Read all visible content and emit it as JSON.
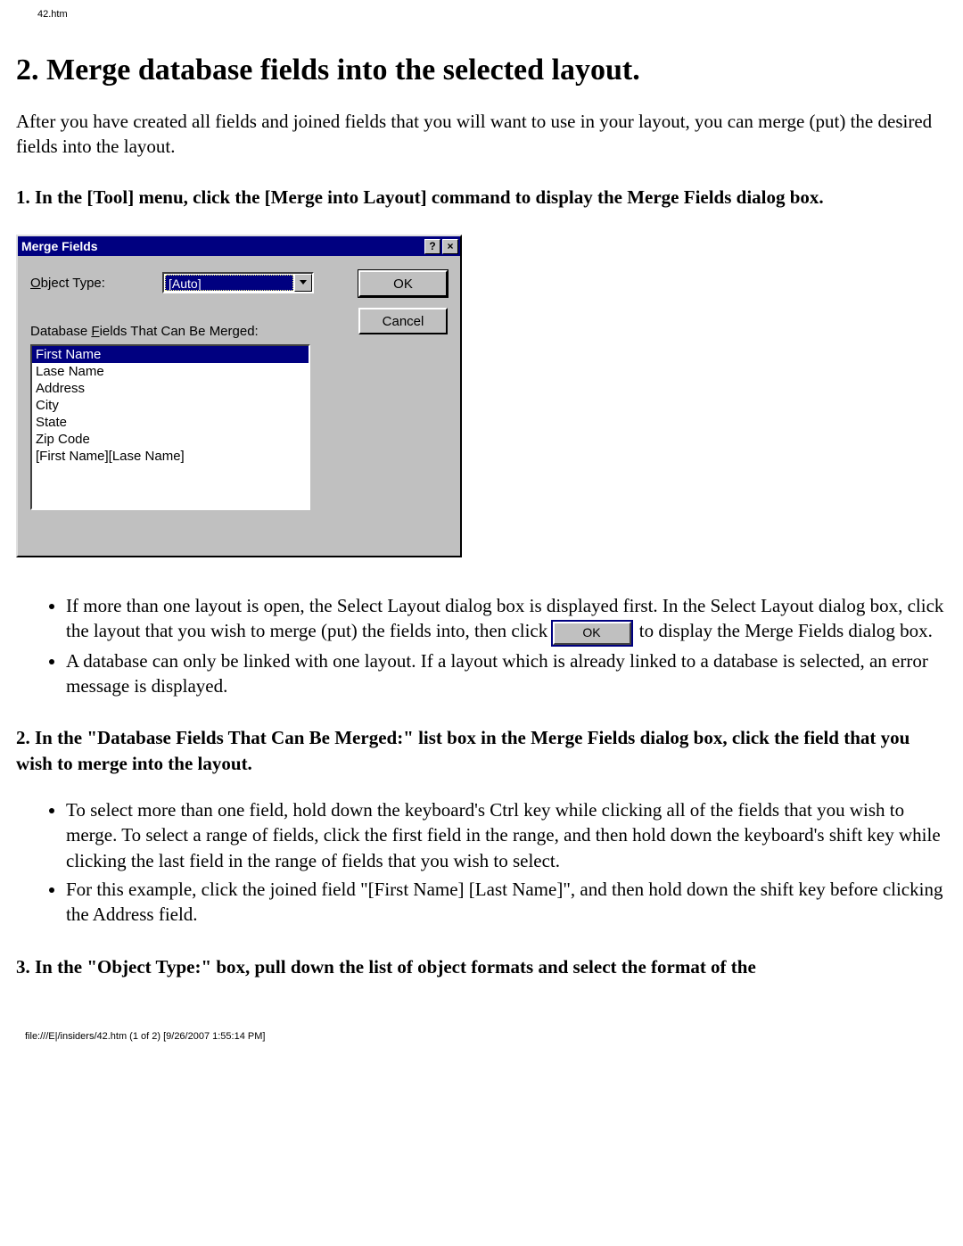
{
  "header": {
    "filename": "42.htm"
  },
  "title": "2. Merge database fields into the selected layout.",
  "intro": "After you have created all fields and joined fields that you will want to use in your layout, you can merge (put) the desired fields into the layout.",
  "step1": {
    "heading": "1. In the [Tool] menu, click the [Merge into Layout] command to display the Merge Fields dialog box.",
    "bullet1_a": "If more than one layout is open, the Select Layout dialog box is displayed first. In the Select Layout dialog box, click the layout that you wish to merge (put) the fields into, then click ",
    "bullet1_btn": "OK",
    "bullet1_b": " to display the Merge Fields dialog box.",
    "bullet2": "A database can only be linked with one layout. If a layout which is already linked to a database is selected, an error message is displayed."
  },
  "step2": {
    "heading": "2. In the \"Database Fields That Can Be Merged:\" list box in the Merge Fields dialog box, click the field that you wish to merge into the layout.",
    "bullet1": "To select more than one field, hold down the keyboard's Ctrl key while clicking all of the fields that you wish to merge. To select a range of fields, click the first field in the range, and then hold down the keyboard's shift key while clicking the last field in the range of fields that you wish to select.",
    "bullet2": "For this example, click the joined field \"[First Name] [Last Name]\", and then hold down the shift key before clicking the Address field."
  },
  "step3": {
    "heading": "3. In the \"Object Type:\" box, pull down the list of object formats and select the format of the"
  },
  "dialog": {
    "title": "Merge Fields",
    "help_icon": "?",
    "close_icon": "×",
    "object_type_prefix": "O",
    "object_type_rest": "bject Type:",
    "object_type_value": "[Auto]",
    "fields_label_a": "Database ",
    "fields_label_u": "F",
    "fields_label_b": "ields That Can Be Merged:",
    "fields": [
      {
        "label": "First Name",
        "selected": true
      },
      {
        "label": "Lase Name",
        "selected": false
      },
      {
        "label": "Address",
        "selected": false
      },
      {
        "label": "City",
        "selected": false
      },
      {
        "label": "State",
        "selected": false
      },
      {
        "label": "Zip Code",
        "selected": false
      },
      {
        "label": "[First Name][Lase Name]",
        "selected": false
      }
    ],
    "ok": "OK",
    "cancel": "Cancel"
  },
  "footer": "file:///E|/insiders/42.htm (1 of 2) [9/26/2007 1:55:14 PM]"
}
